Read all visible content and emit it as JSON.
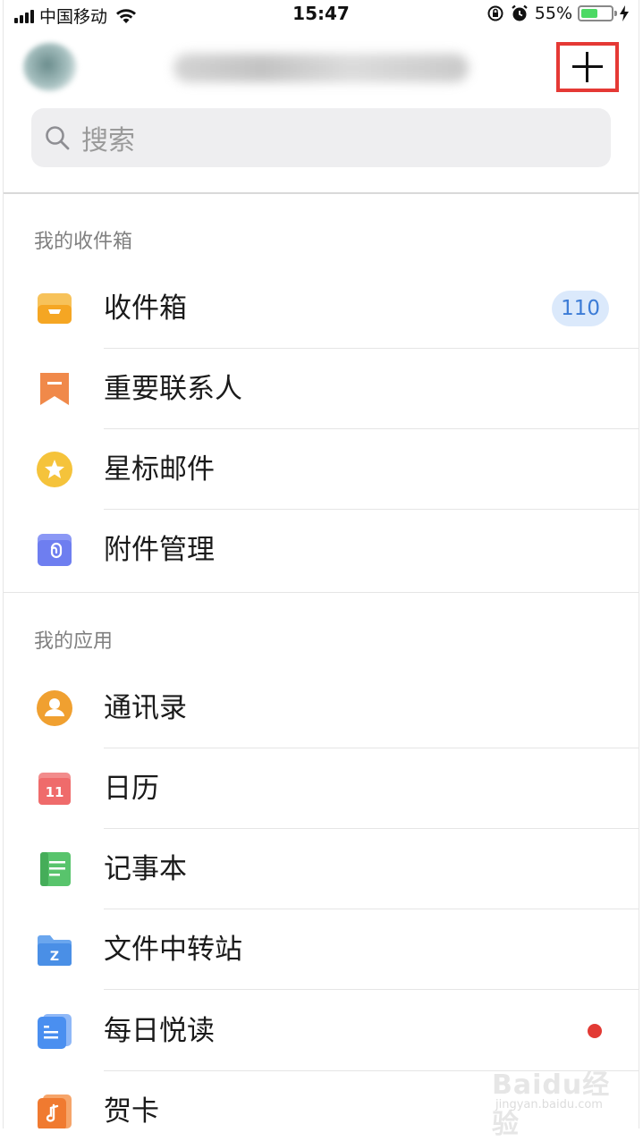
{
  "status_bar": {
    "carrier": "中国移动",
    "time": "15:47",
    "battery_percent": "55%",
    "battery_level": 0.55
  },
  "header": {
    "add_icon": "plus-icon"
  },
  "search": {
    "placeholder": "搜索",
    "icon": "search-icon"
  },
  "mailbox_section": {
    "title": "我的收件箱",
    "items": [
      {
        "label": "收件箱",
        "icon": "inbox-icon",
        "badge": "110"
      },
      {
        "label": "重要联系人",
        "icon": "bookmark-icon"
      },
      {
        "label": "星标邮件",
        "icon": "star-icon"
      },
      {
        "label": "附件管理",
        "icon": "attachment-icon"
      }
    ]
  },
  "apps_section": {
    "title": "我的应用",
    "items": [
      {
        "label": "通讯录",
        "icon": "contacts-icon"
      },
      {
        "label": "日历",
        "icon": "calendar-icon",
        "icon_text": "11"
      },
      {
        "label": "记事本",
        "icon": "notepad-icon"
      },
      {
        "label": "文件中转站",
        "icon": "file-transfer-icon",
        "icon_text": "Z"
      },
      {
        "label": "每日悦读",
        "icon": "daily-reading-icon",
        "has_dot": true
      },
      {
        "label": "贺卡",
        "icon": "greeting-card-icon"
      }
    ]
  },
  "colors": {
    "inbox": "#f5b233",
    "bookmark": "#f0894a",
    "star": "#f5c33b",
    "attachment": "#6e7ef0",
    "contacts": "#f0a030",
    "calendar": "#ef6b6b",
    "notepad": "#58c46c",
    "file_transfer": "#4a8fe6",
    "daily_reading": "#4a8ff0",
    "greeting_card": "#f07a30",
    "badge_bg": "#dbe9fb",
    "badge_text": "#3b7bd6",
    "highlight": "#e53935"
  },
  "watermark": {
    "logo": "Baidu经验",
    "url": "jingyan.baidu.com"
  }
}
